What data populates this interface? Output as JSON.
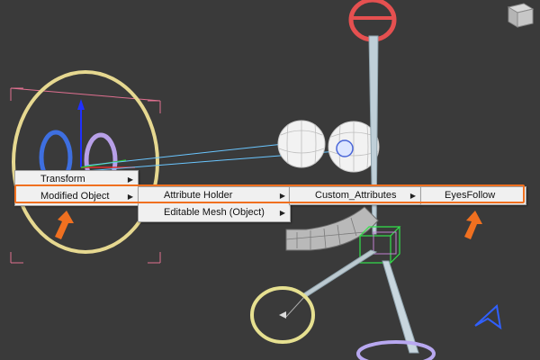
{
  "context_menu": {
    "level1": [
      {
        "label": "Transform"
      },
      {
        "label": "Modified Object"
      }
    ],
    "level2": [
      {
        "label": "Attribute Holder"
      },
      {
        "label": "Editable Mesh (Object)"
      }
    ],
    "level3": [
      {
        "label": "Custom_Attributes"
      }
    ],
    "level4": [
      {
        "label": "EyesFollow"
      }
    ]
  },
  "colors": {
    "viewport_bg": "#3a3a3a",
    "highlight": "#f07020",
    "menu_bg": "#f0f0f0"
  },
  "icons": [
    "viewcube-icon",
    "view-orientation-icon",
    "annotation-arrow-icon"
  ]
}
